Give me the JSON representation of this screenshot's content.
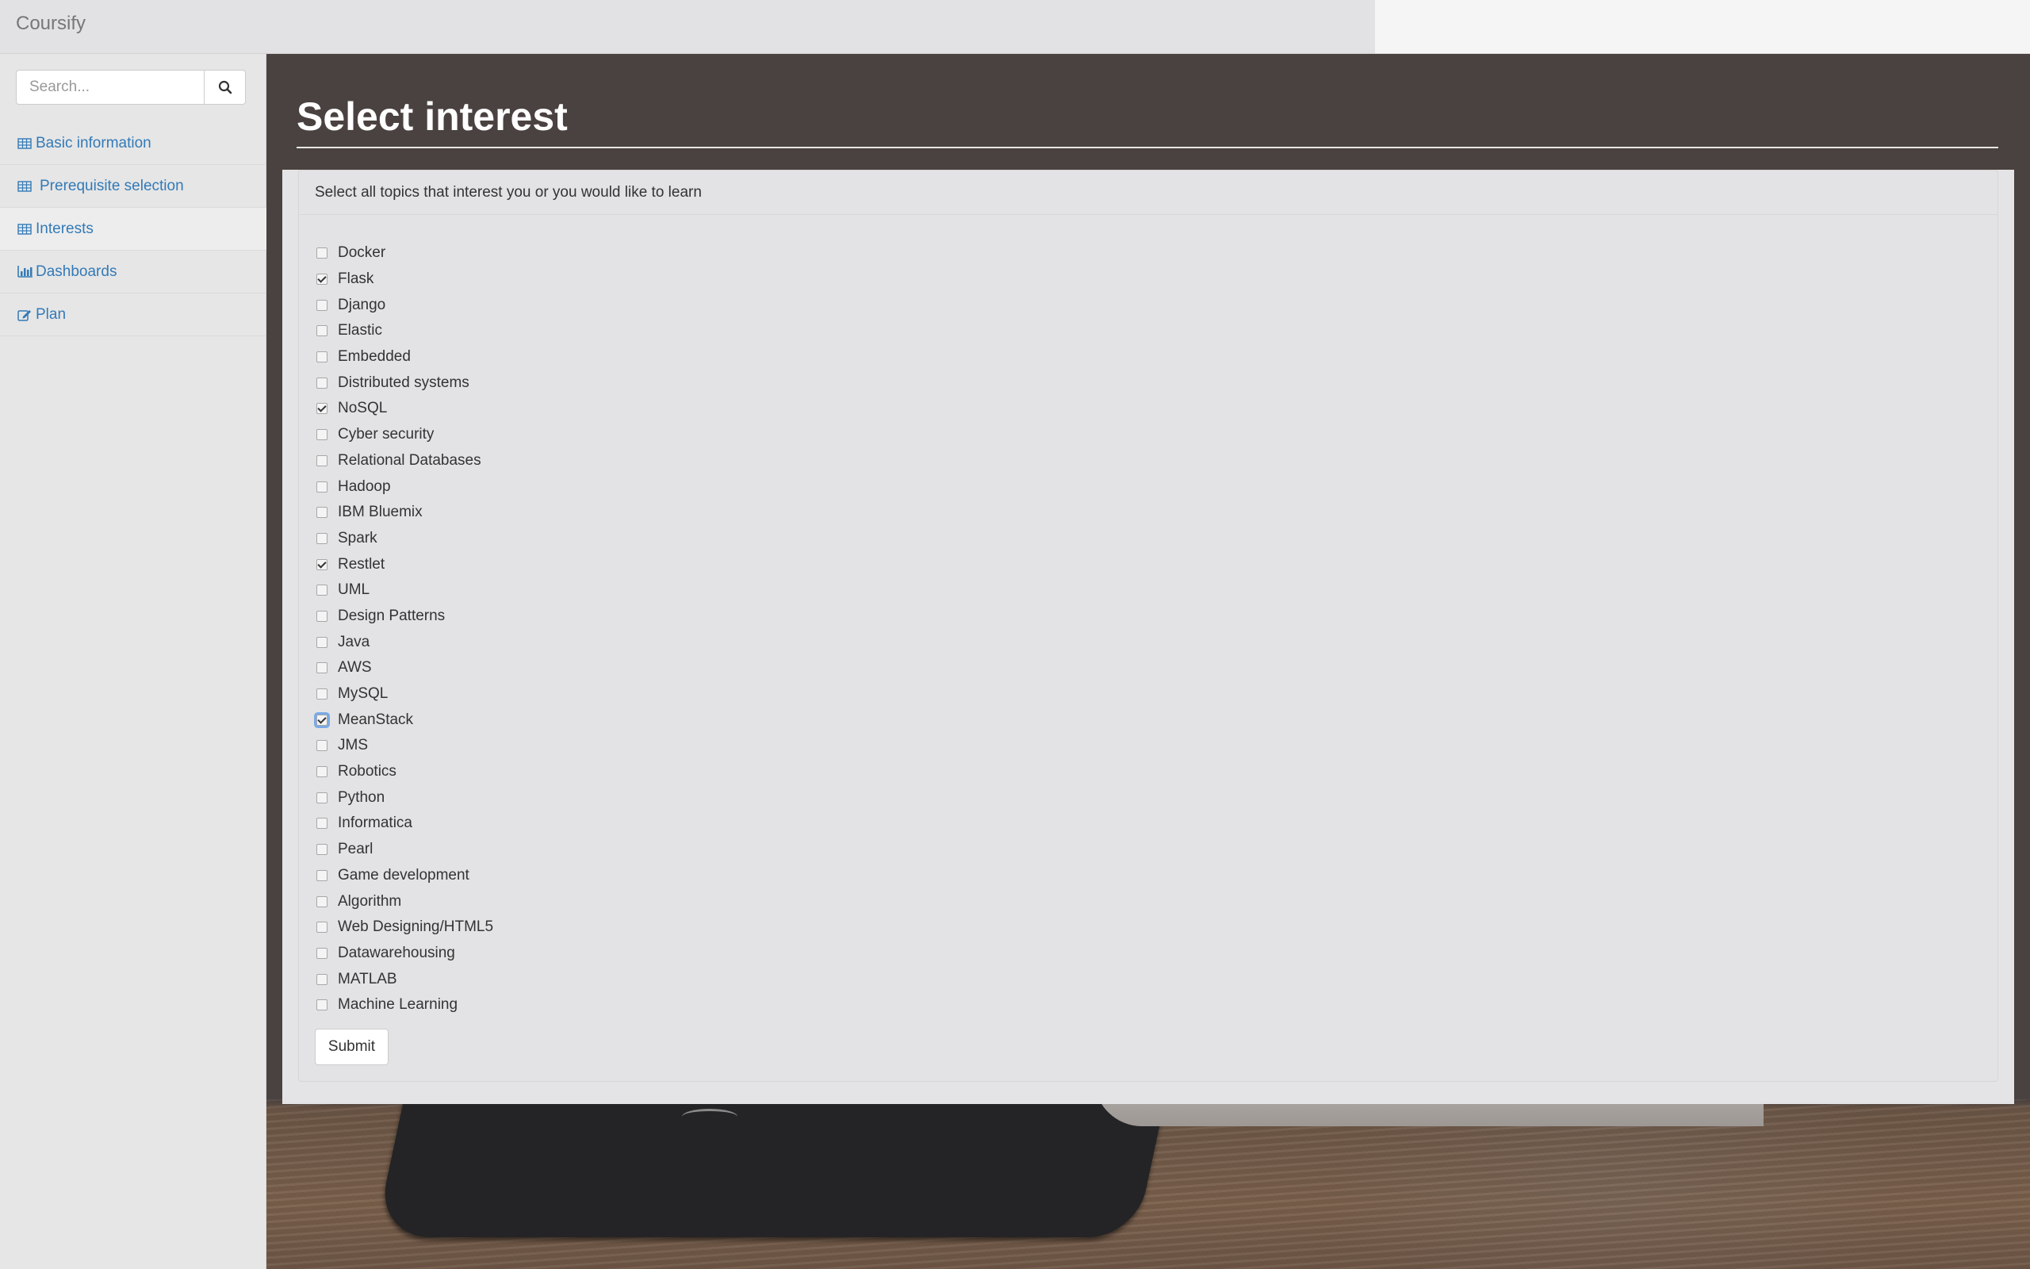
{
  "app": {
    "brand": "Coursify"
  },
  "sidebar": {
    "search": {
      "placeholder": "Search..."
    },
    "items": [
      {
        "label": "Basic information",
        "icon": "table-icon"
      },
      {
        "label": "Prerequisite selection",
        "icon": "table-icon"
      },
      {
        "label": "Interests",
        "icon": "table-icon",
        "active": true
      },
      {
        "label": "Dashboards",
        "icon": "bar-chart-icon"
      },
      {
        "label": "Plan",
        "icon": "edit-icon"
      }
    ]
  },
  "main": {
    "title": "Select interest",
    "panel_heading": "Select all topics that interest you or you would like to learn",
    "topics": [
      {
        "label": "Docker",
        "checked": false
      },
      {
        "label": "Flask",
        "checked": true
      },
      {
        "label": "Django",
        "checked": false
      },
      {
        "label": "Elastic",
        "checked": false
      },
      {
        "label": "Embedded",
        "checked": false
      },
      {
        "label": "Distributed systems",
        "checked": false
      },
      {
        "label": "NoSQL",
        "checked": true
      },
      {
        "label": "Cyber security",
        "checked": false
      },
      {
        "label": "Relational Databases",
        "checked": false
      },
      {
        "label": "Hadoop",
        "checked": false
      },
      {
        "label": "IBM Bluemix",
        "checked": false
      },
      {
        "label": "Spark",
        "checked": false
      },
      {
        "label": "Restlet",
        "checked": true
      },
      {
        "label": "UML",
        "checked": false
      },
      {
        "label": "Design Patterns",
        "checked": false
      },
      {
        "label": "Java",
        "checked": false
      },
      {
        "label": "AWS",
        "checked": false
      },
      {
        "label": "MySQL",
        "checked": false
      },
      {
        "label": "MeanStack",
        "checked": true,
        "focused": true
      },
      {
        "label": "JMS",
        "checked": false
      },
      {
        "label": "Robotics",
        "checked": false
      },
      {
        "label": "Python",
        "checked": false
      },
      {
        "label": "Informatica",
        "checked": false
      },
      {
        "label": "Pearl",
        "checked": false
      },
      {
        "label": "Game development",
        "checked": false
      },
      {
        "label": "Algorithm",
        "checked": false
      },
      {
        "label": "Web Designing/HTML5",
        "checked": false
      },
      {
        "label": "Datawarehousing",
        "checked": false
      },
      {
        "label": "MATLAB",
        "checked": false
      },
      {
        "label": "Machine Learning",
        "checked": false
      }
    ],
    "submit_label": "Submit"
  },
  "colors": {
    "link": "#337ab7",
    "title": "#ffffff"
  }
}
